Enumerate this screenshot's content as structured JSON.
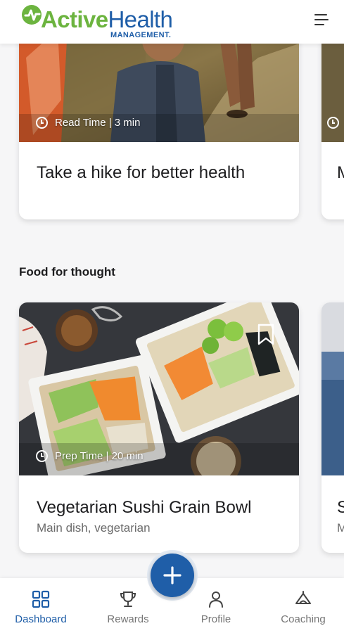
{
  "header": {
    "brand_part1": "Active",
    "brand_part2": "Health",
    "brand_sub": "MANAGEMENT.",
    "menu_icon": "hamburger-menu-icon"
  },
  "cards": {
    "hike": {
      "time_label": "Read Time | 3 min",
      "title": "Take a hike for better health"
    },
    "peek_top_letter": "M",
    "sushi": {
      "time_label": "Prep Time | 20 min",
      "title": "Vegetarian Sushi Grain Bowl",
      "subtitle": "Main dish, vegetarian",
      "bookmark_icon": "bookmark-icon"
    },
    "peek_bottom_title_letter": "S",
    "peek_bottom_sub_letter": "M"
  },
  "sections": {
    "food_heading": "Food for thought"
  },
  "nav": {
    "items": [
      {
        "label": "Dashboard",
        "icon": "dashboard-grid-icon",
        "active": true
      },
      {
        "label": "Rewards",
        "icon": "trophy-icon",
        "active": false
      },
      {
        "label": "Profile",
        "icon": "person-icon",
        "active": false
      },
      {
        "label": "Coaching",
        "icon": "coaching-icon",
        "active": false
      }
    ],
    "fab_icon": "plus-icon"
  },
  "colors": {
    "brand_blue": "#1f5ea8",
    "brand_green": "#6cb43f",
    "background": "#f6f6f7",
    "inactive_nav": "#767676"
  }
}
